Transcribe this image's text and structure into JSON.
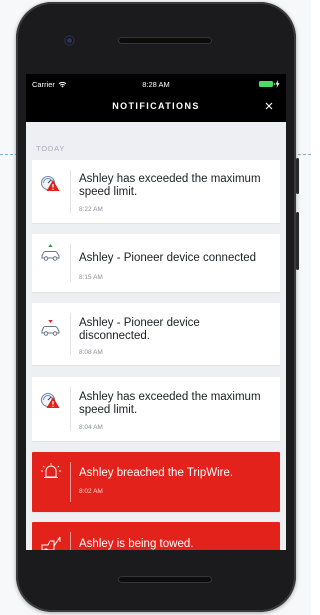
{
  "status_bar": {
    "carrier": "Carrier",
    "time": "8:28 AM"
  },
  "header": {
    "title": "NOTIFICATIONS",
    "close_icon": "close-icon"
  },
  "section": {
    "label": "TODAY"
  },
  "notifications": [
    {
      "message": "Ashley has exceeded the maximum speed limit.",
      "time": "8:22 AM",
      "icon": "speedometer-alert-icon",
      "alert": false
    },
    {
      "message": "Ashley - Pioneer device connected",
      "time": "8:15 AM",
      "icon": "car-connected-icon",
      "alert": false
    },
    {
      "message": "Ashley - Pioneer device disconnected.",
      "time": "8:08 AM",
      "icon": "car-disconnected-icon",
      "alert": false
    },
    {
      "message": "Ashley has exceeded the maximum speed limit.",
      "time": "8:04 AM",
      "icon": "speedometer-alert-icon",
      "alert": false
    },
    {
      "message": "Ashley breached the TripWire.",
      "time": "8:02 AM",
      "icon": "tripwire-alarm-icon",
      "alert": true
    },
    {
      "message": "Ashley is being towed.",
      "time": "",
      "icon": "tow-truck-icon",
      "alert": true
    }
  ],
  "colors": {
    "alert": "#e3221b",
    "card": "#ffffff",
    "background": "#eeeff2",
    "battery": "#4cd964"
  }
}
